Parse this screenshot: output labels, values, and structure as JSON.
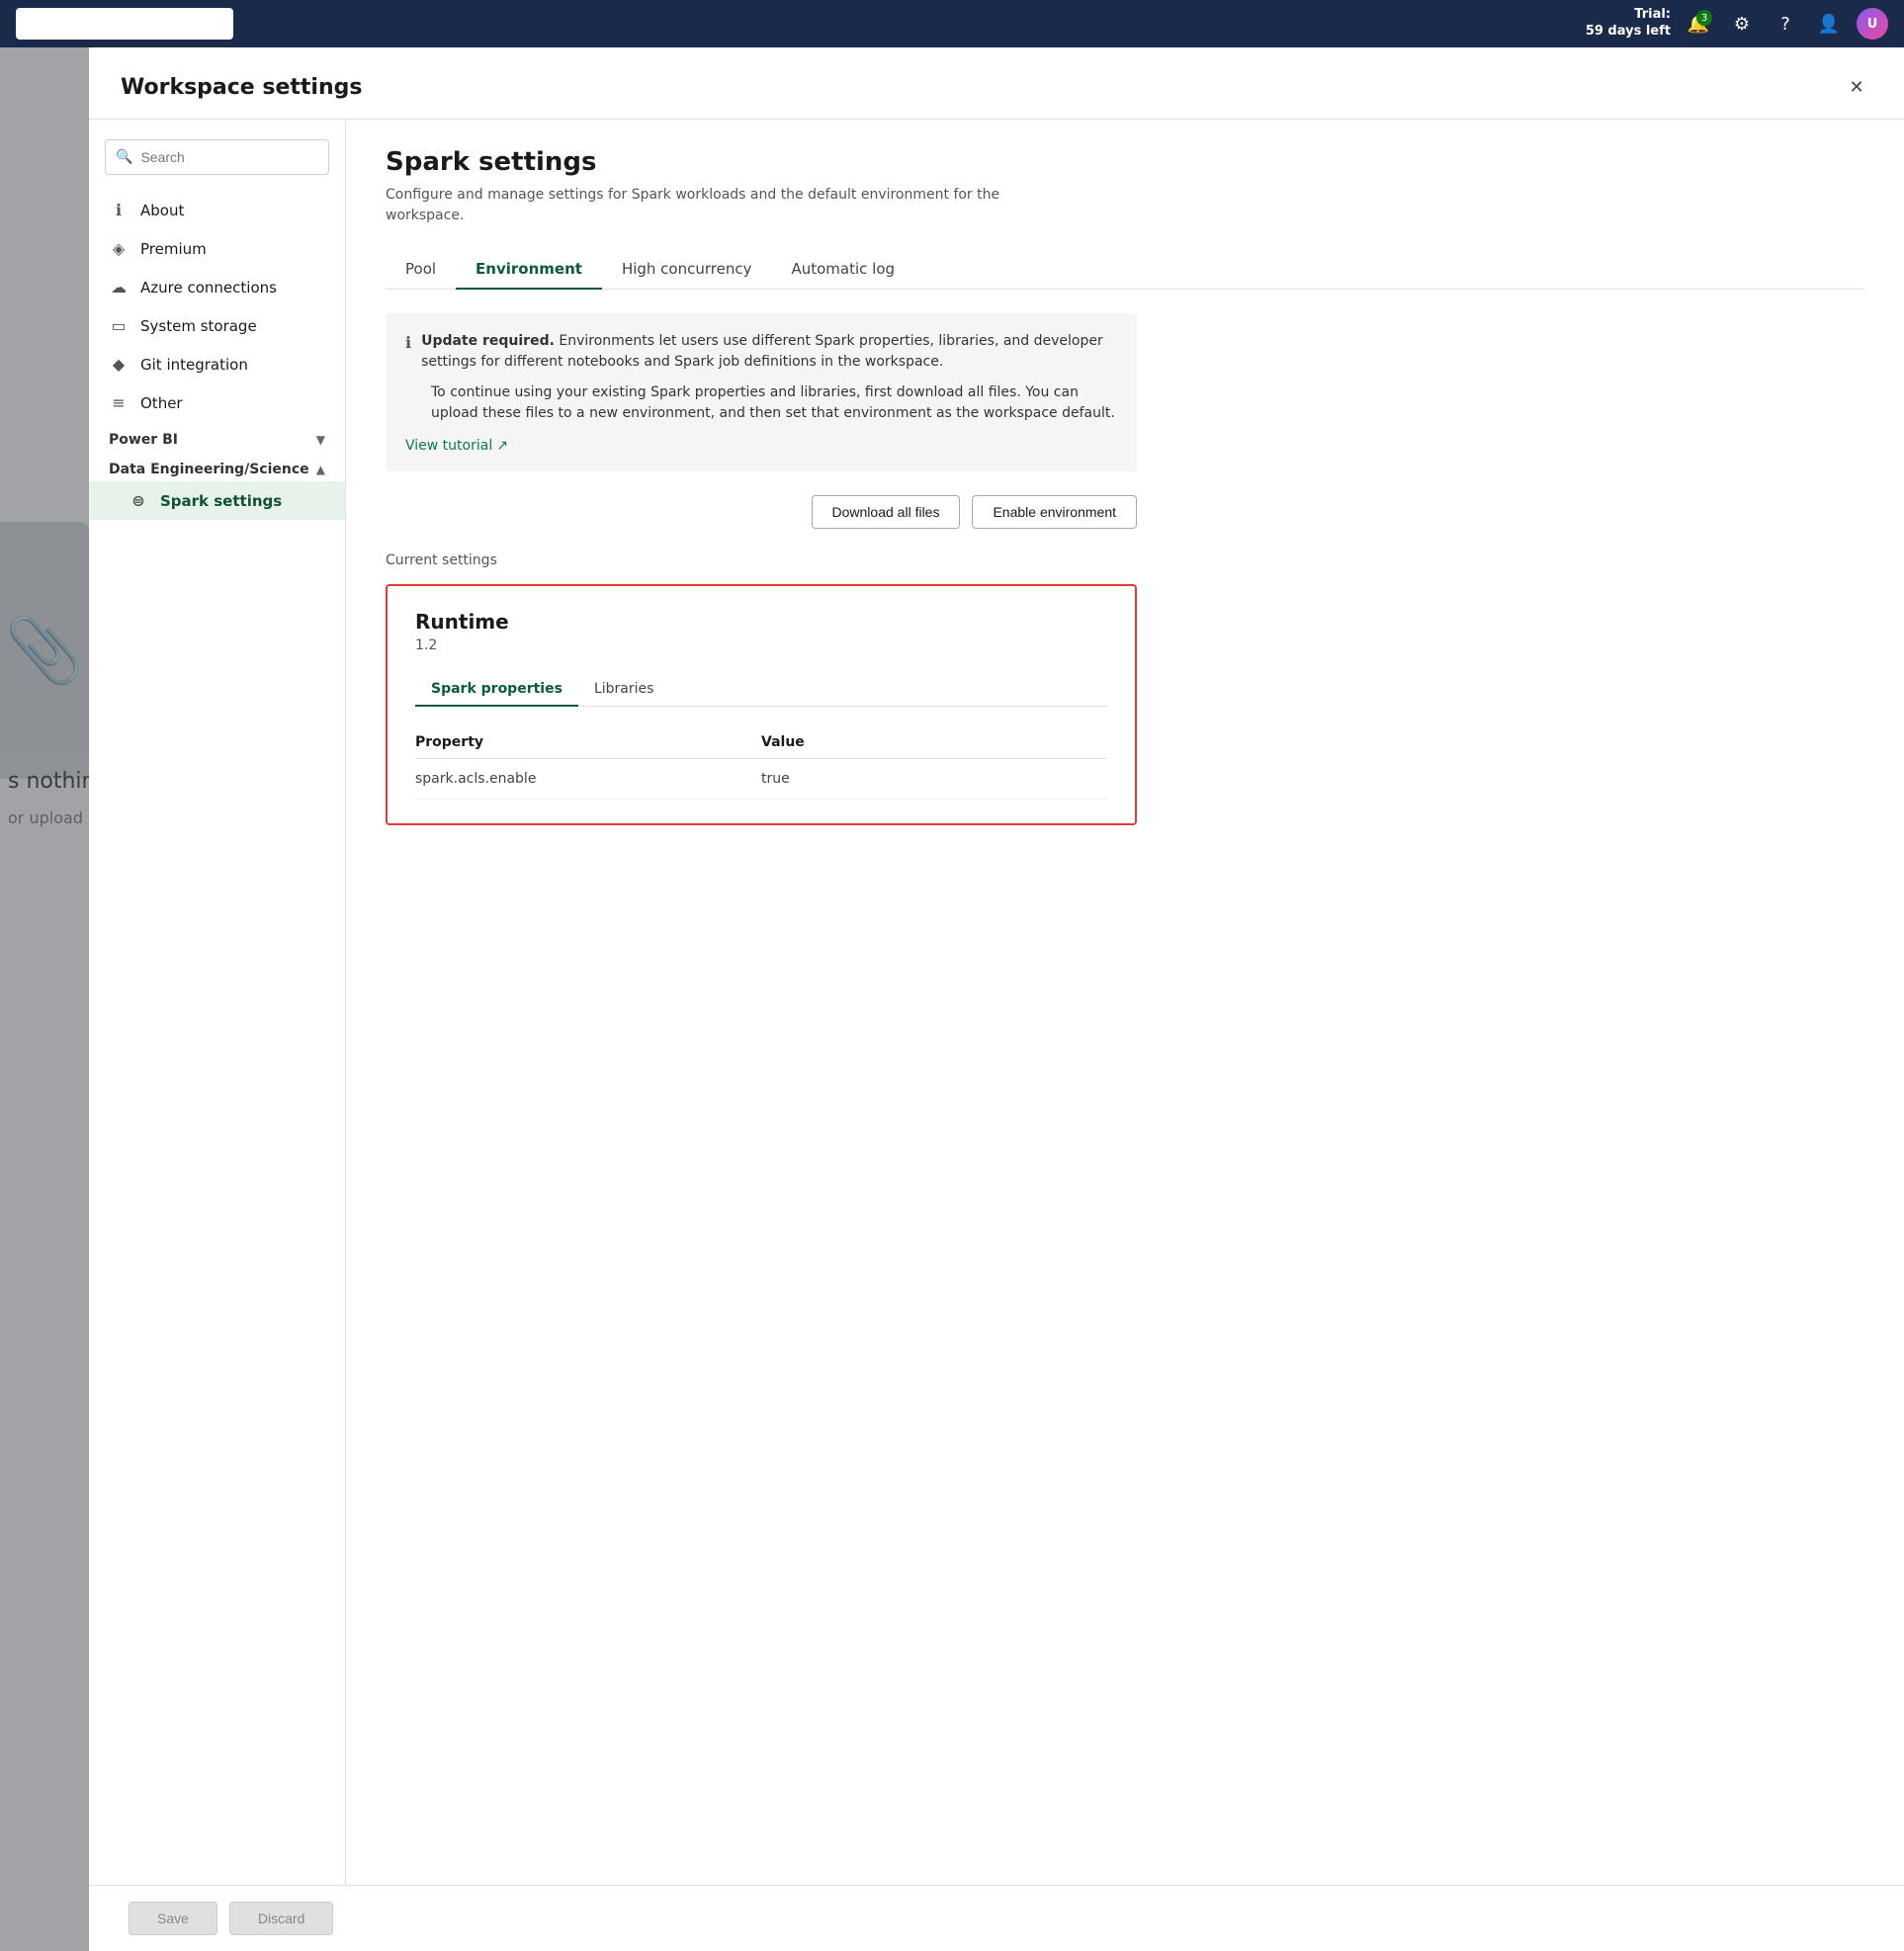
{
  "topbar": {
    "trial_line1": "Trial:",
    "trial_line2": "59 days left",
    "notif_badge": "3"
  },
  "background": {
    "nothing_text": "s nothing",
    "nothing_sub": "or upload som"
  },
  "modal": {
    "title": "Workspace settings",
    "close_label": "×",
    "search_placeholder": "Search",
    "sidebar": {
      "items": [
        {
          "id": "about",
          "label": "About",
          "icon": "ℹ"
        },
        {
          "id": "premium",
          "label": "Premium",
          "icon": "◈"
        },
        {
          "id": "azure",
          "label": "Azure connections",
          "icon": "☁"
        },
        {
          "id": "storage",
          "label": "System storage",
          "icon": "▭"
        },
        {
          "id": "git",
          "label": "Git integration",
          "icon": "◆"
        },
        {
          "id": "other",
          "label": "Other",
          "icon": "≡"
        }
      ],
      "sections": [
        {
          "id": "powerbi",
          "label": "Power BI",
          "expanded": false
        },
        {
          "id": "dataeng",
          "label": "Data Engineering/Science",
          "expanded": true
        }
      ],
      "active_item": "spark-settings",
      "spark_label": "Spark settings"
    },
    "content": {
      "page_title": "Spark settings",
      "page_desc": "Configure and manage settings for Spark workloads and the default environment for the workspace.",
      "tabs": [
        {
          "id": "pool",
          "label": "Pool"
        },
        {
          "id": "environment",
          "label": "Environment",
          "active": true
        },
        {
          "id": "high_concurrency",
          "label": "High concurrency"
        },
        {
          "id": "automatic_log",
          "label": "Automatic log"
        }
      ],
      "banner": {
        "bold_text": "Update required.",
        "text1": " Environments let users use different Spark properties, libraries, and developer settings for different notebooks and Spark job definitions in the workspace.",
        "text2": "To continue using your existing Spark properties and libraries, first download all files. You can upload these files to a new environment, and then set that environment as the workspace default.",
        "link_label": "View tutorial",
        "link_icon": "↗"
      },
      "actions": {
        "download_btn": "Download all files",
        "enable_btn": "Enable environment"
      },
      "current_settings_label": "Current settings",
      "runtime": {
        "title": "Runtime",
        "version": "1.2",
        "inner_tabs": [
          {
            "id": "spark_props",
            "label": "Spark properties",
            "active": true
          },
          {
            "id": "libraries",
            "label": "Libraries"
          }
        ],
        "table": {
          "col_property": "Property",
          "col_value": "Value",
          "rows": [
            {
              "property": "spark.acls.enable",
              "value": "true"
            }
          ]
        }
      }
    },
    "footer": {
      "save_label": "Save",
      "discard_label": "Discard"
    }
  }
}
